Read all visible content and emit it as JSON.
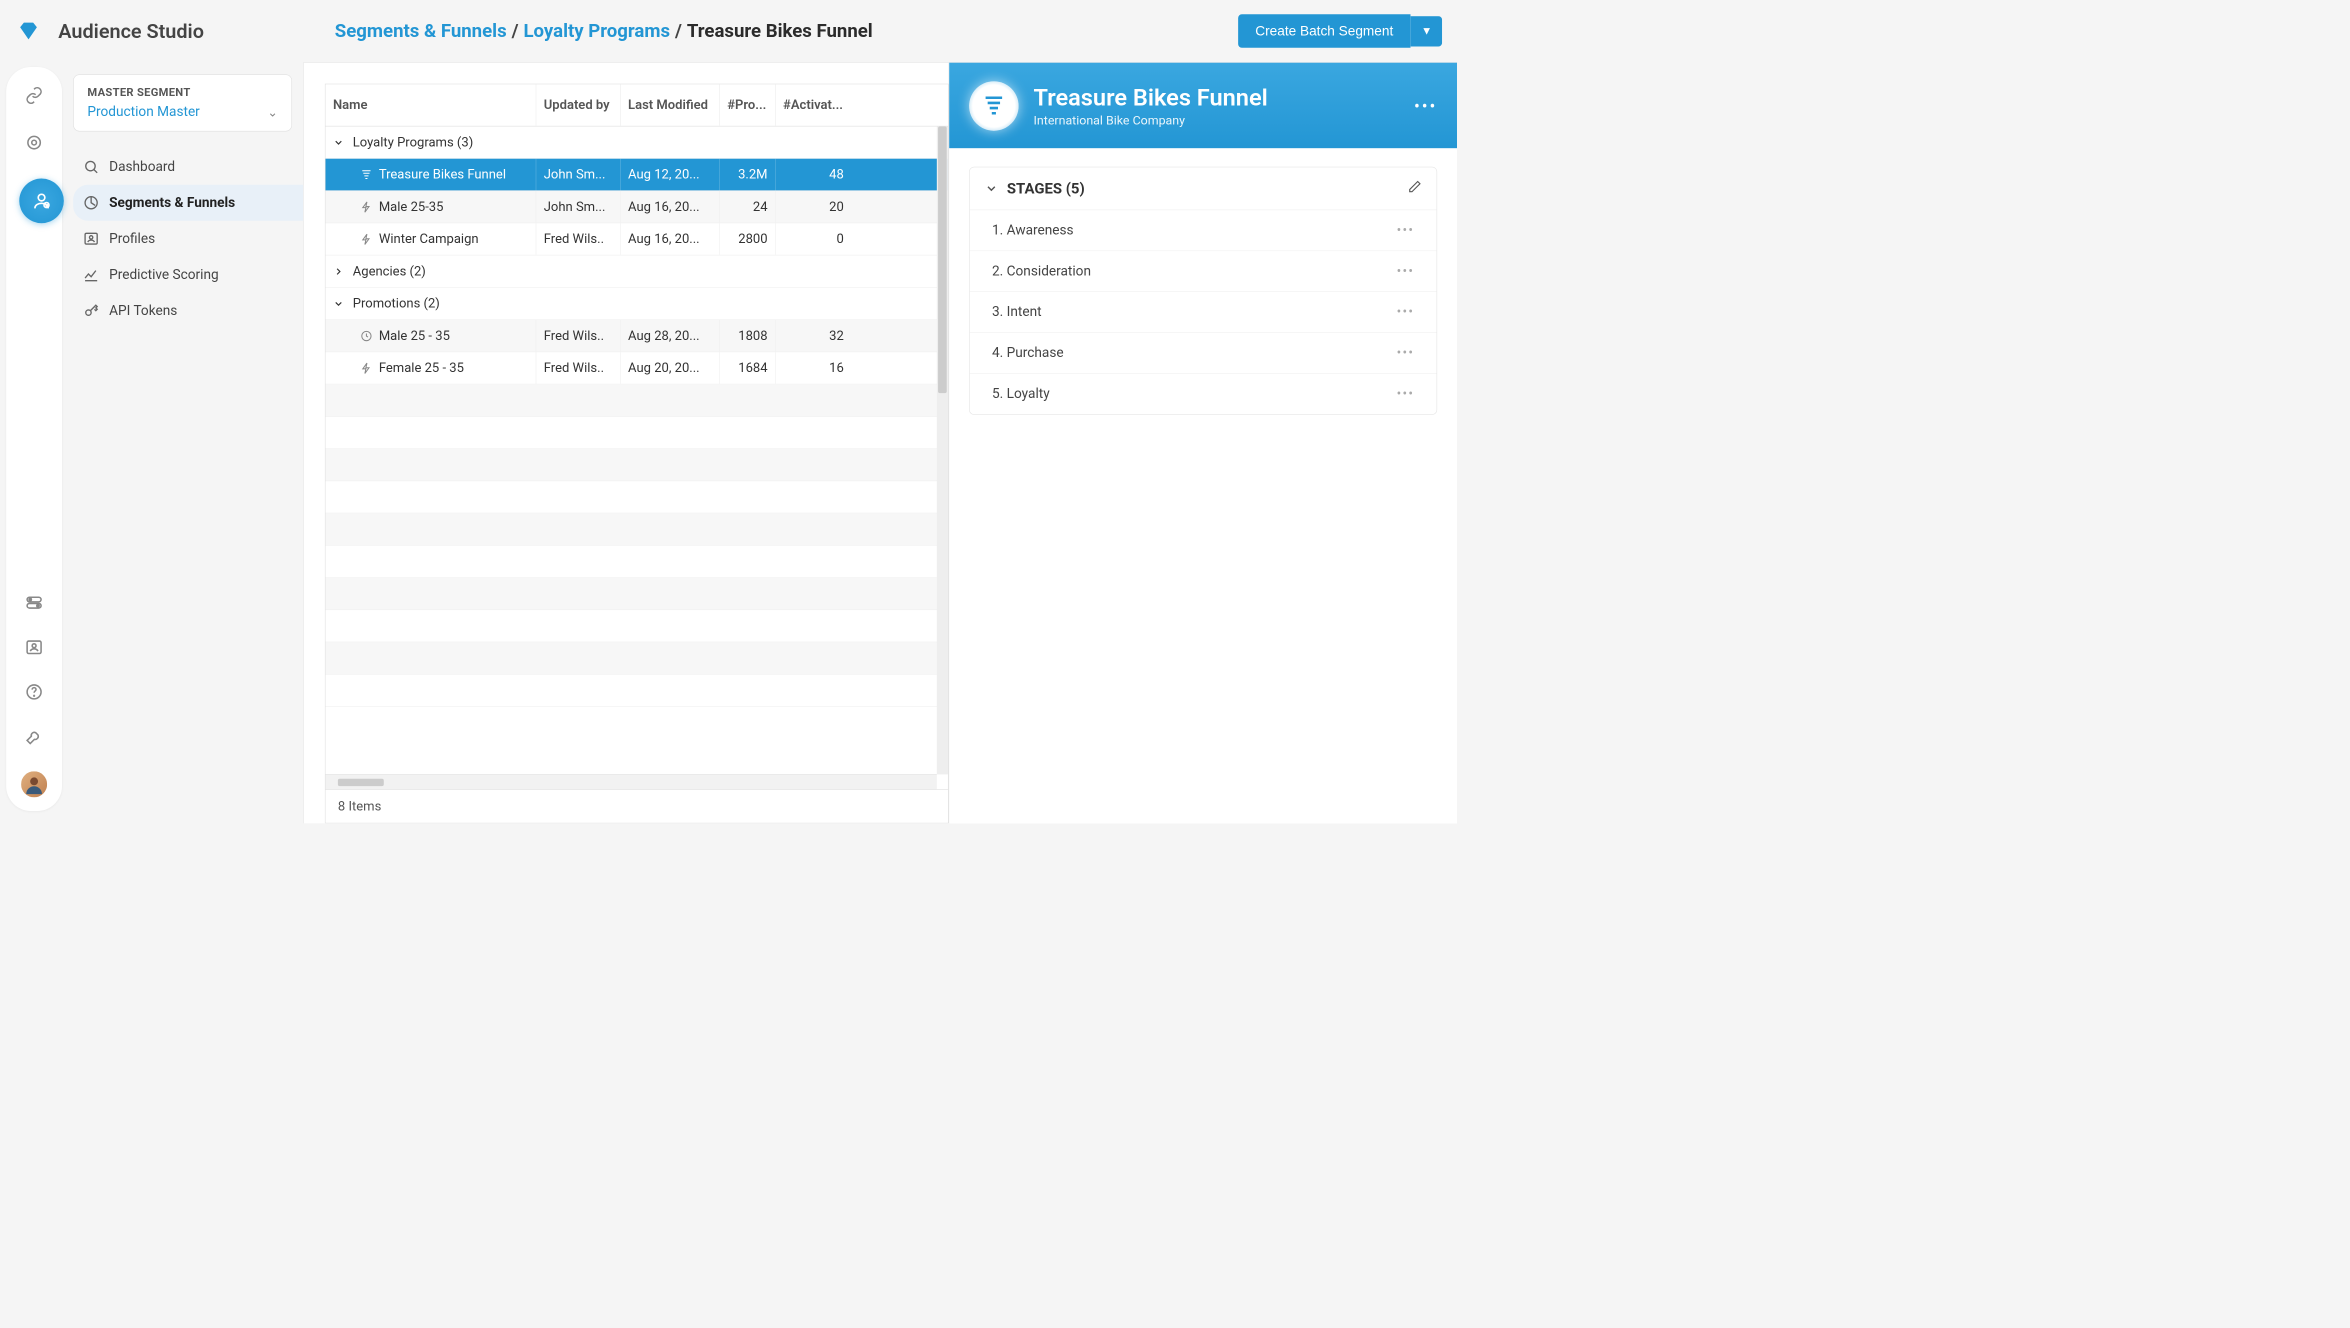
{
  "app": {
    "title": "Audience Studio"
  },
  "breadcrumb": {
    "root": "Segments & Funnels",
    "mid": "Loyalty Programs",
    "current": "Treasure Bikes Funnel"
  },
  "header": {
    "create_button": "Create Batch Segment"
  },
  "sidebar": {
    "master_segment_label": "MASTER SEGMENT",
    "master_segment_value": "Production Master",
    "items": [
      {
        "label": "Dashboard"
      },
      {
        "label": "Segments & Funnels"
      },
      {
        "label": "Profiles"
      },
      {
        "label": "Predictive Scoring"
      },
      {
        "label": "API Tokens"
      }
    ]
  },
  "table": {
    "columns": {
      "name": "Name",
      "updated_by": "Updated by",
      "last_modified": "Last Modified",
      "profiles": "#Pro...",
      "activations": "#Activat..."
    },
    "groups": [
      {
        "title": "Loyalty Programs (3)",
        "expanded": true,
        "rows": [
          {
            "name": "Treasure Bikes Funnel",
            "updated_by": "John Sm...",
            "last_modified": "Aug 12, 20...",
            "profiles": "3.2M",
            "activations": "48",
            "selected": true,
            "icon": "funnel"
          },
          {
            "name": "Male 25-35",
            "updated_by": "John Sm...",
            "last_modified": "Aug 16, 20...",
            "profiles": "24",
            "activations": "20",
            "icon": "bolt"
          },
          {
            "name": "Winter Campaign",
            "updated_by": "Fred Wils..",
            "last_modified": "Aug 16, 20...",
            "profiles": "2800",
            "activations": "0",
            "icon": "bolt"
          }
        ]
      },
      {
        "title": "Agencies (2)",
        "expanded": false,
        "rows": []
      },
      {
        "title": "Promotions (2)",
        "expanded": true,
        "rows": [
          {
            "name": "Male 25 - 35",
            "updated_by": "Fred Wils..",
            "last_modified": "Aug 28, 20...",
            "profiles": "1808",
            "activations": "32",
            "icon": "clock"
          },
          {
            "name": "Female 25 - 35",
            "updated_by": "Fred Wils..",
            "last_modified": "Aug 20, 20...",
            "profiles": "1684",
            "activations": "16",
            "icon": "bolt"
          }
        ]
      }
    ],
    "footer": "8 Items"
  },
  "detail": {
    "title": "Treasure Bikes Funnel",
    "subtitle": "International Bike Company",
    "stages_header": "STAGES (5)",
    "stages": [
      {
        "label": "1. Awareness"
      },
      {
        "label": "2. Consideration"
      },
      {
        "label": "3. Intent"
      },
      {
        "label": "4. Purchase"
      },
      {
        "label": "5. Loyalty"
      }
    ]
  }
}
